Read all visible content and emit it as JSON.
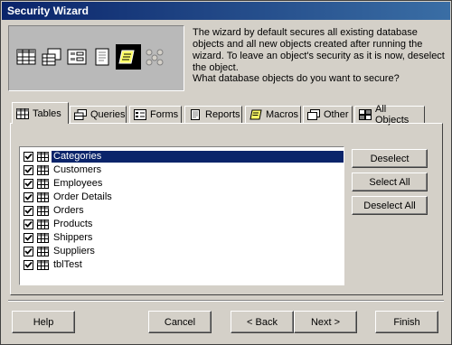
{
  "window": {
    "title": "Security Wizard"
  },
  "banner": {
    "icons": [
      "table-icon",
      "query-icon",
      "form-icon",
      "report-icon",
      "macro-icon",
      "relationships-icon"
    ],
    "selected": "macro-icon"
  },
  "description": "The wizard by default secures all existing database objects and all new objects created after running the wizard. To leave an object's security as it is now, deselect the object.",
  "question": "What database objects do you want to secure?",
  "tabs": [
    {
      "label": "Tables",
      "icon": "table-icon",
      "active": true
    },
    {
      "label": "Queries",
      "icon": "query-icon"
    },
    {
      "label": "Forms",
      "icon": "form-icon"
    },
    {
      "label": "Reports",
      "icon": "report-icon"
    },
    {
      "label": "Macros",
      "icon": "macro-icon"
    },
    {
      "label": "Other",
      "icon": "other-icon"
    },
    {
      "label": "All Objects",
      "icon": "all-objects-icon"
    }
  ],
  "list": {
    "items": [
      {
        "label": "Categories",
        "checked": true,
        "selected": true
      },
      {
        "label": "Customers",
        "checked": true
      },
      {
        "label": "Employees",
        "checked": true
      },
      {
        "label": "Order Details",
        "checked": true
      },
      {
        "label": "Orders",
        "checked": true
      },
      {
        "label": "Products",
        "checked": true
      },
      {
        "label": "Shippers",
        "checked": true
      },
      {
        "label": "Suppliers",
        "checked": true
      },
      {
        "label": "tblTest",
        "checked": true
      }
    ]
  },
  "side_buttons": {
    "deselect": "Deselect",
    "select_all": "Select All",
    "deselect_all": "Deselect All"
  },
  "footer": {
    "help": "Help",
    "cancel": "Cancel",
    "back": "< Back",
    "next": "Next >",
    "finish": "Finish"
  },
  "colors": {
    "title_bar": "#0a246a",
    "selection": "#0a246a",
    "face": "#d4d0c8"
  }
}
